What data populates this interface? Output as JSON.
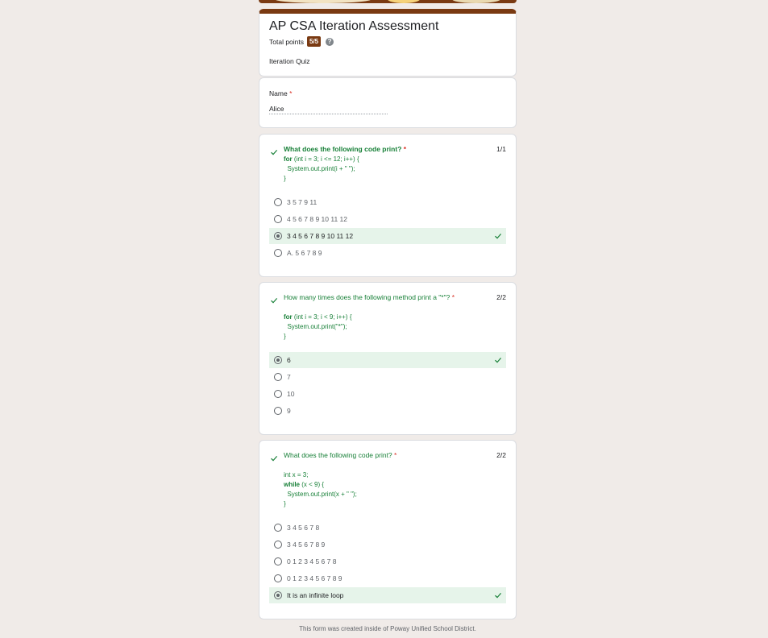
{
  "form": {
    "title": "AP CSA Iteration Assessment",
    "total_points_label": "Total points",
    "score": "5/5",
    "description": "Iteration Quiz"
  },
  "name_field": {
    "label": "Name",
    "required_mark": "*",
    "value": "Alice"
  },
  "questions": [
    {
      "text": "What does the following code print?",
      "required_mark": "*",
      "score": "1/1",
      "code_lines": [
        {
          "kw": "for",
          "rest": " (int i = 3; i <= 12; i++) {"
        },
        {
          "kw": "",
          "rest": "  System.out.print(i + \" \");"
        },
        {
          "kw": "",
          "rest": "}"
        }
      ],
      "options": [
        "3 5 7 9 11",
        "4 5 6 7 8 9 10 11 12",
        "3 4 5 6 7 8 9 10 11 12",
        "A. 5 6 7 8 9"
      ],
      "selected_index": 2
    },
    {
      "text": "How many times does the following method print a \"*\"?",
      "required_mark": "*",
      "score": "2/2",
      "code_lines": [
        {
          "kw": "for",
          "rest": " (int i = 3; i < 9; i++) {"
        },
        {
          "kw": "",
          "rest": "  System.out.print(\"*\");"
        },
        {
          "kw": "",
          "rest": "}"
        }
      ],
      "options": [
        "6",
        "7",
        "10",
        "9"
      ],
      "selected_index": 0
    },
    {
      "text": "What does the following code print?",
      "required_mark": "*",
      "score": "2/2",
      "code_lines": [
        {
          "kw": "",
          "rest": "int x = 3;"
        },
        {
          "kw": "while",
          "rest": " (x < 9) {"
        },
        {
          "kw": "",
          "rest": "  System.out.print(x + \" \");"
        },
        {
          "kw": "",
          "rest": "}"
        }
      ],
      "options": [
        "3 4 5 6 7 8",
        "3 4 5 6 7 8 9",
        "0 1 2 3 4 5 6 7 8",
        "0 1 2 3 4 5 6 7 8 9",
        "It is an infinite loop"
      ],
      "selected_index": 4
    }
  ],
  "footer": "This form was created inside of Poway Unified School District.",
  "colors": {
    "theme": "#7a3a12",
    "correct_text": "#188038",
    "correct_bg": "#e6f4ea",
    "required": "#d93025"
  }
}
